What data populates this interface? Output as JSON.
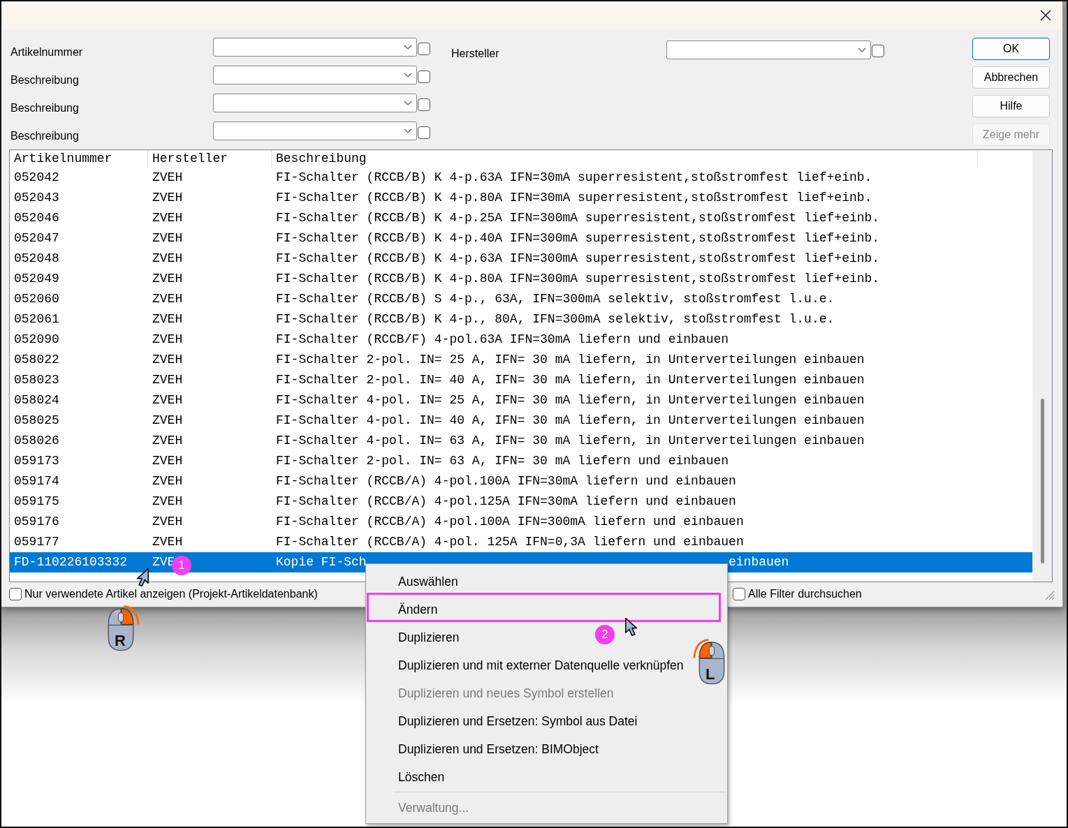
{
  "filters": [
    {
      "label": "Artikelnummer",
      "checked": false
    },
    {
      "label": "Beschreibung",
      "checked": false
    },
    {
      "label": "Beschreibung",
      "checked": false
    },
    {
      "label": "Beschreibung",
      "checked": false
    }
  ],
  "manufacturer_filter": {
    "label": "Hersteller",
    "checked": false
  },
  "buttons": [
    {
      "label": "OK",
      "kind": "default",
      "disabled": false
    },
    {
      "label": "Abbrechen",
      "kind": "normal",
      "disabled": false
    },
    {
      "label": "Hilfe",
      "kind": "normal",
      "disabled": false
    },
    {
      "label": "Zeige mehr",
      "kind": "normal",
      "disabled": true
    }
  ],
  "table": {
    "columns": [
      "Artikelnummer",
      "Hersteller",
      "Beschreibung"
    ],
    "rows": [
      {
        "cells": [
          "052042",
          "ZVEH",
          "FI-Schalter (RCCB/B) K 4-p.63A IFN=30mA superresistent,stoßstromfest lief+einb."
        ],
        "selected": false
      },
      {
        "cells": [
          "052043",
          "ZVEH",
          "FI-Schalter (RCCB/B) K 4-p.80A IFN=30mA superresistent,stoßstromfest lief+einb."
        ],
        "selected": false
      },
      {
        "cells": [
          "052046",
          "ZVEH",
          "FI-Schalter (RCCB/B) K 4-p.25A IFN=300mA superresistent,stoßstromfest lief+einb."
        ],
        "selected": false
      },
      {
        "cells": [
          "052047",
          "ZVEH",
          "FI-Schalter (RCCB/B) K 4-p.40A IFN=300mA superresistent,stoßstromfest lief+einb."
        ],
        "selected": false
      },
      {
        "cells": [
          "052048",
          "ZVEH",
          "FI-Schalter (RCCB/B) K 4-p.63A IFN=300mA superresistent,stoßstromfest lief+einb."
        ],
        "selected": false
      },
      {
        "cells": [
          "052049",
          "ZVEH",
          "FI-Schalter (RCCB/B) K 4-p.80A IFN=300mA superresistent,stoßstromfest lief+einb."
        ],
        "selected": false
      },
      {
        "cells": [
          "052060",
          "ZVEH",
          "FI-Schalter (RCCB/B) S 4-p., 63A, IFN=300mA selektiv, stoßstromfest l.u.e."
        ],
        "selected": false
      },
      {
        "cells": [
          "052061",
          "ZVEH",
          "FI-Schalter (RCCB/B) K 4-p., 80A, IFN=300mA selektiv, stoßstromfest l.u.e."
        ],
        "selected": false
      },
      {
        "cells": [
          "052090",
          "ZVEH",
          "FI-Schalter (RCCB/F) 4-pol.63A IFN=30mA liefern und einbauen"
        ],
        "selected": false
      },
      {
        "cells": [
          "058022",
          "ZVEH",
          "FI-Schalter 2-pol. IN= 25 A, IFN= 30 mA liefern, in Unterverteilungen einbauen"
        ],
        "selected": false
      },
      {
        "cells": [
          "058023",
          "ZVEH",
          "FI-Schalter 2-pol. IN= 40 A, IFN= 30 mA liefern, in Unterverteilungen einbauen"
        ],
        "selected": false
      },
      {
        "cells": [
          "058024",
          "ZVEH",
          "FI-Schalter 4-pol. IN= 25 A, IFN= 30 mA liefern, in Unterverteilungen einbauen"
        ],
        "selected": false
      },
      {
        "cells": [
          "058025",
          "ZVEH",
          "FI-Schalter 4-pol. IN= 40 A, IFN= 30 mA liefern, in Unterverteilungen einbauen"
        ],
        "selected": false
      },
      {
        "cells": [
          "058026",
          "ZVEH",
          "FI-Schalter 4-pol. IN= 63 A, IFN= 30 mA liefern, in Unterverteilungen einbauen"
        ],
        "selected": false
      },
      {
        "cells": [
          "059173",
          "ZVEH",
          "FI-Schalter 2-pol. IN= 63 A, IFN= 30 mA liefern und einbauen"
        ],
        "selected": false
      },
      {
        "cells": [
          "059174",
          "ZVEH",
          "FI-Schalter (RCCB/A) 4-pol.100A IFN=30mA liefern und einbauen"
        ],
        "selected": false
      },
      {
        "cells": [
          "059175",
          "ZVEH",
          "FI-Schalter (RCCB/A) 4-pol.125A IFN=30mA liefern und einbauen"
        ],
        "selected": false
      },
      {
        "cells": [
          "059176",
          "ZVEH",
          "FI-Schalter (RCCB/A) 4-pol.100A IFN=300mA liefern und einbauen"
        ],
        "selected": false
      },
      {
        "cells": [
          "059177",
          "ZVEH",
          "FI-Schalter (RCCB/A) 4-pol. 125A IFN=0,3A liefern und einbauen"
        ],
        "selected": false
      },
      {
        "cells": [
          "FD-110226103332",
          "ZVE",
          "Kopie FI-Sch"
        ],
        "trailing": "einbauen",
        "selected": true
      }
    ]
  },
  "options": [
    {
      "label": "Nur verwendete Artikel anzeigen (Projekt-Artikeldatenbank)",
      "checked": false
    },
    {
      "label": "Alle Filter durchsuchen",
      "checked": false
    }
  ],
  "context_menu": {
    "items": [
      {
        "kind": "item",
        "label": "Auswählen",
        "disabled": false,
        "highlighted": false
      },
      {
        "kind": "item",
        "label": "Ändern",
        "disabled": false,
        "highlighted": true
      },
      {
        "kind": "item",
        "label": "Duplizieren",
        "disabled": false,
        "highlighted": false
      },
      {
        "kind": "item",
        "label": "Duplizieren und mit externer Datenquelle verknüpfen",
        "disabled": false,
        "highlighted": false
      },
      {
        "kind": "item",
        "label": "Duplizieren und neues Symbol erstellen",
        "disabled": true,
        "highlighted": false
      },
      {
        "kind": "item",
        "label": "Duplizieren und Ersetzen: Symbol aus Datei",
        "disabled": false,
        "highlighted": false
      },
      {
        "kind": "item",
        "label": "Duplizieren und Ersetzen: BIMObject",
        "disabled": false,
        "highlighted": false
      },
      {
        "kind": "item",
        "label": "Löschen",
        "disabled": false,
        "highlighted": false
      },
      {
        "kind": "separator"
      },
      {
        "kind": "item",
        "label": "Verwaltung...",
        "disabled": true,
        "highlighted": false
      }
    ]
  },
  "annotations": [
    {
      "kind": "step",
      "label": "1"
    },
    {
      "kind": "step",
      "label": "2"
    },
    {
      "kind": "mouse-right",
      "label": "R"
    },
    {
      "kind": "mouse-left",
      "label": "L"
    }
  ]
}
